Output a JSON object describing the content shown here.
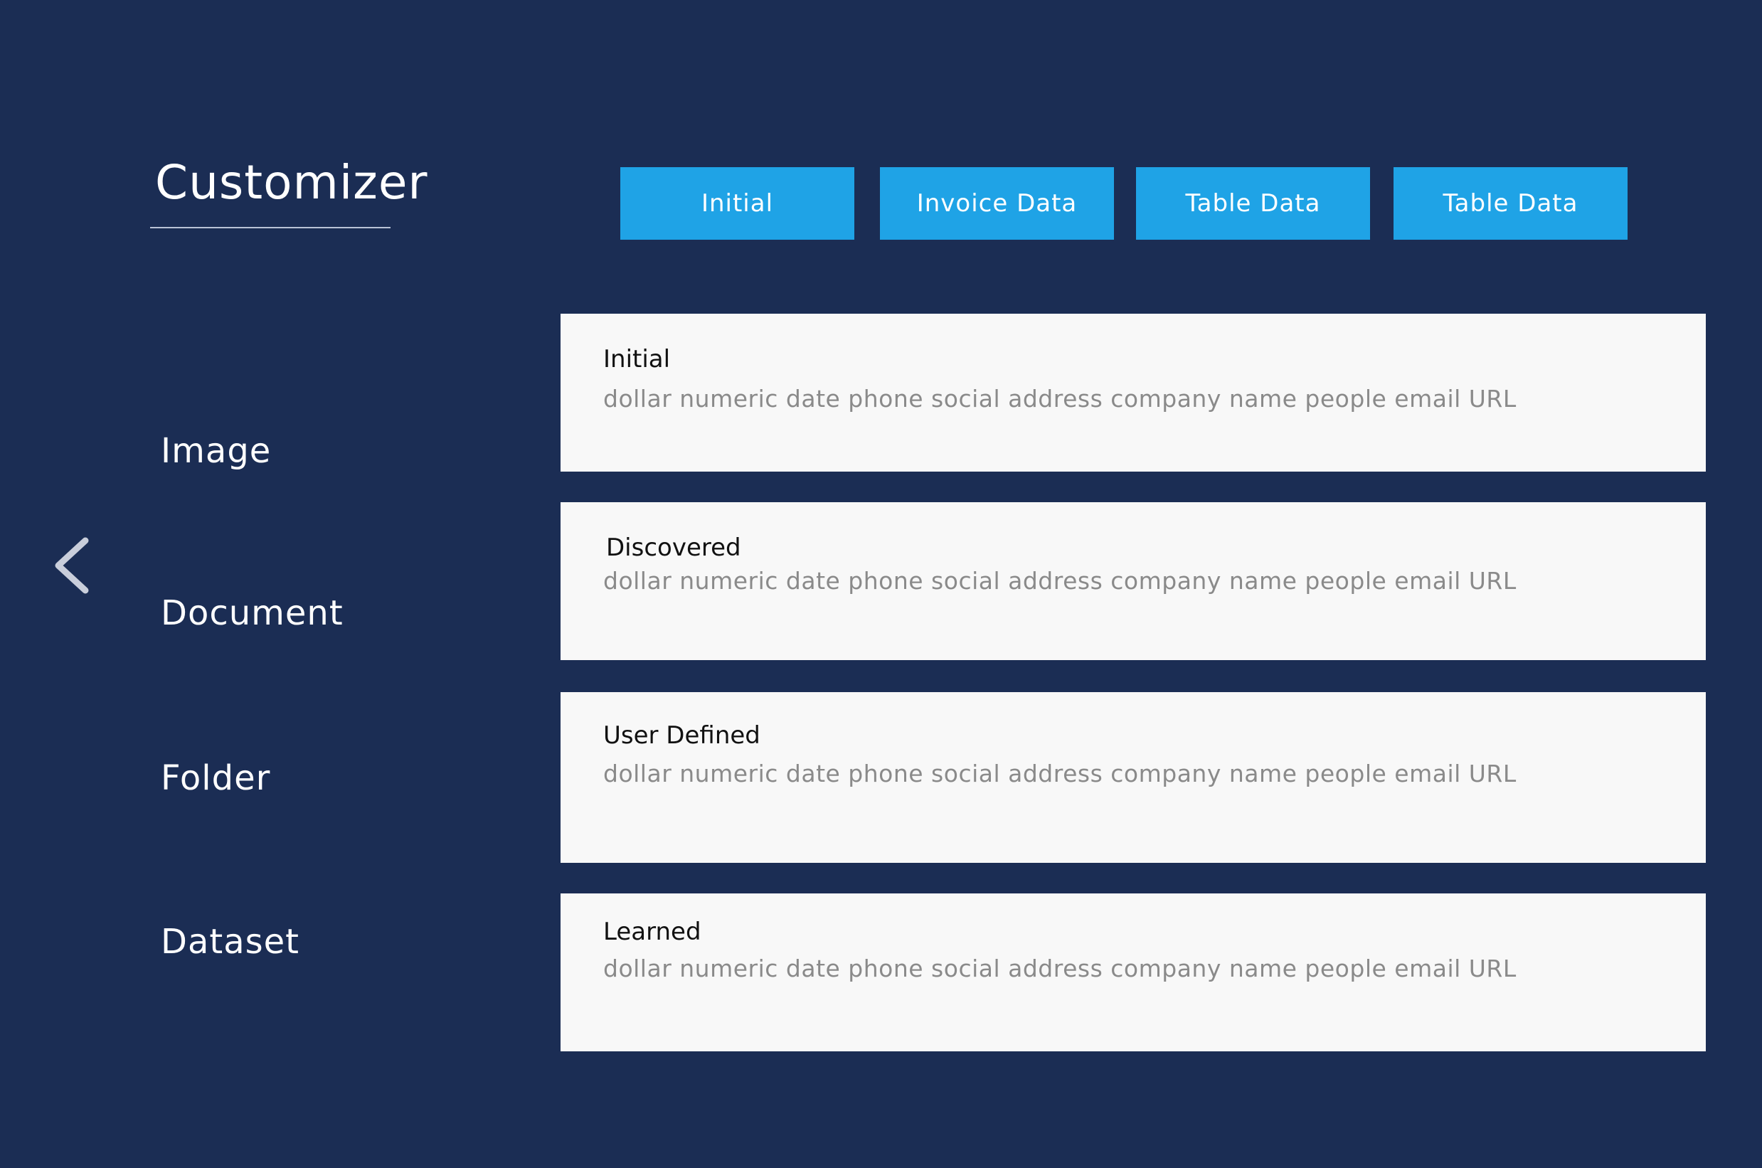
{
  "header": {
    "title": "Customizer"
  },
  "tabs": [
    {
      "label": "Initial"
    },
    {
      "label": "Invoice Data"
    },
    {
      "label": "Table Data"
    },
    {
      "label": "Table Data"
    }
  ],
  "sidebar": {
    "back_icon": "chevron-left-icon",
    "items": [
      {
        "label": "Image"
      },
      {
        "label": "Document"
      },
      {
        "label": "Folder"
      },
      {
        "label": "Dataset"
      }
    ]
  },
  "cards": [
    {
      "title": "Initial",
      "types": "dollar numeric date phone social address company name people email URL"
    },
    {
      "title": "Discovered",
      "types": "dollar numeric date phone social address company name people email URL"
    },
    {
      "title": "User Defined",
      "types": "dollar numeric date phone social address company name people email URL"
    },
    {
      "title": "Learned",
      "types": "dollar numeric date phone social address company name people email URL"
    }
  ],
  "colors": {
    "background": "#1b2d54",
    "tab_accent": "#1fa3e6",
    "card_background": "#f8f8f8",
    "card_text_muted": "#8a8a8a"
  }
}
